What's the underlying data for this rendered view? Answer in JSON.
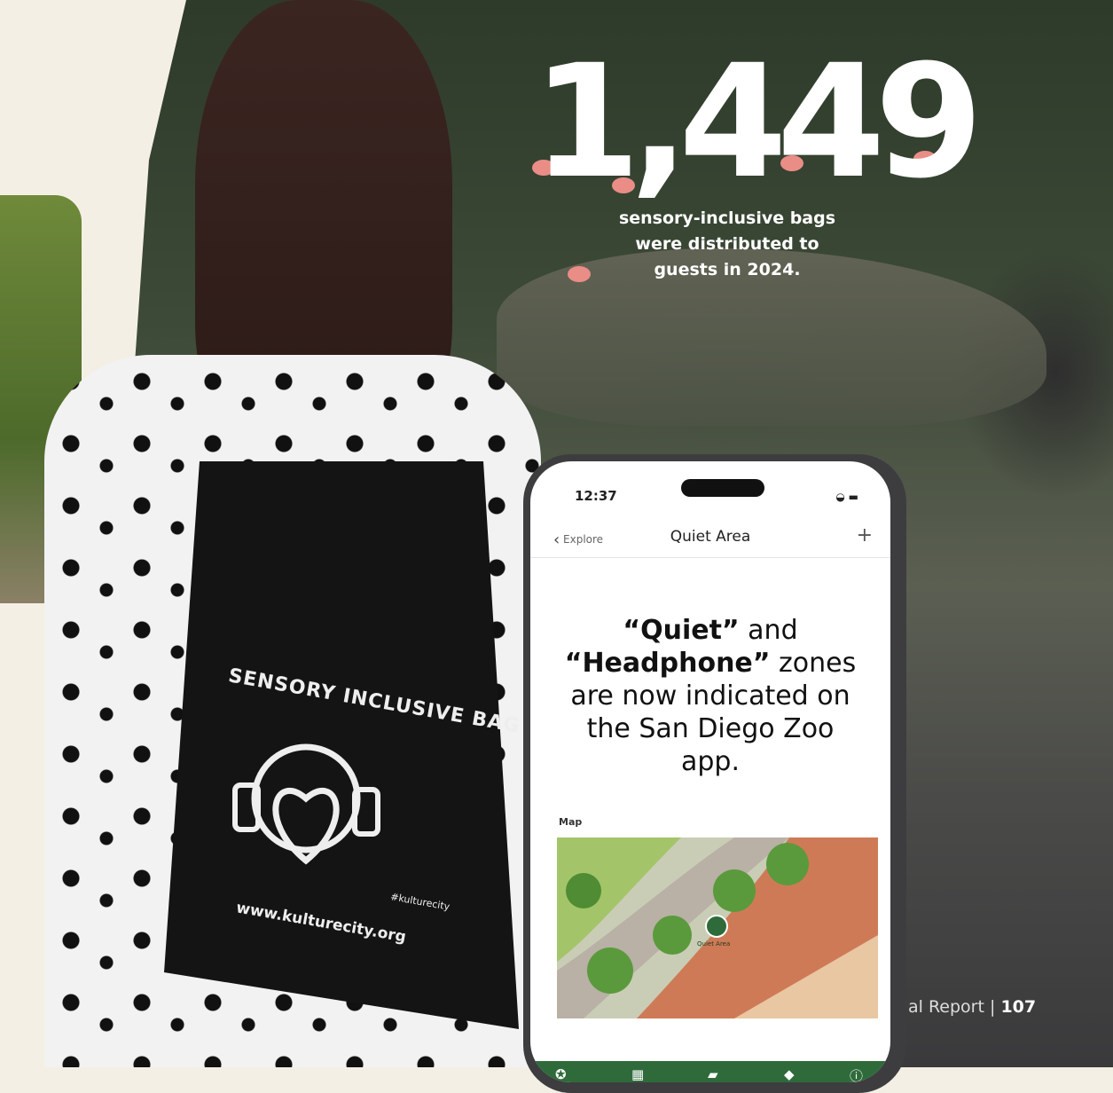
{
  "stat": {
    "number": "1,449",
    "caption_line1": "sensory-inclusive bags",
    "caption_line2": "were distributed to",
    "caption_line3": "guests in 2024."
  },
  "bag": {
    "title": "SENSORY INCLUSIVE BAG™",
    "url": "www.kulturecity.org",
    "hashtag": "#kulturecity"
  },
  "phone": {
    "time": "12:37",
    "back_label": "Explore",
    "title": "Quiet Area",
    "add_label": "+",
    "message": {
      "quote1": "“Quiet”",
      "and": " and ",
      "quote2": "“Headphone”",
      "rest": " zones are now indicated on the San Diego Zoo app."
    },
    "map_label": "Map",
    "map_marker_label": "Quiet Area",
    "tabs": [
      "compass-icon",
      "calendar-icon",
      "wallet-icon",
      "tag-icon",
      "info-icon"
    ]
  },
  "footer": {
    "text": "al Report",
    "separator": "|",
    "page_number": "107"
  },
  "colors": {
    "app_green": "#2f6b3a",
    "background_cream": "#f4efe4"
  }
}
